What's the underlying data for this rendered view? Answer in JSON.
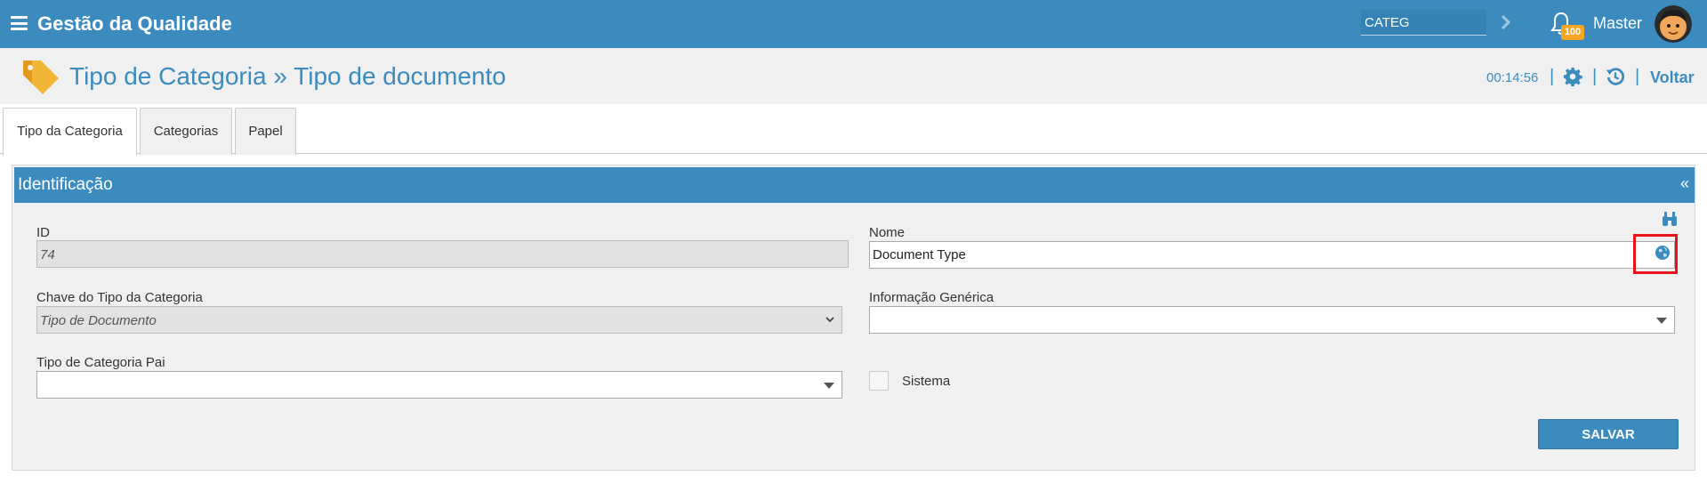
{
  "topbar": {
    "app_title": "Gestão da Qualidade",
    "search_value": "CATEG",
    "notification_count": "100",
    "user_name": "Master"
  },
  "header": {
    "page_title": "Tipo de Categoria » Tipo de documento",
    "timer": "00:14:56",
    "back_label": "Voltar"
  },
  "tabs": [
    {
      "label": "Tipo da Categoria",
      "active": true
    },
    {
      "label": "Categorias",
      "active": false
    },
    {
      "label": "Papel",
      "active": false
    }
  ],
  "panel": {
    "title": "Identificação",
    "collapse_glyph": "«"
  },
  "form": {
    "id_label": "ID",
    "id_value": "74",
    "nome_label": "Nome",
    "nome_value": "Document Type",
    "chave_label": "Chave do Tipo da Categoria",
    "chave_value": "Tipo de Documento",
    "info_label": "Informação Genérica",
    "info_value": "",
    "pai_label": "Tipo de Categoria Pai",
    "pai_value": "",
    "sistema_label": "Sistema",
    "sistema_checked": false,
    "save_label": "SALVAR"
  },
  "colors": {
    "primary": "#3b8bbf",
    "badge": "#f5a623",
    "highlight": "#e8141b"
  },
  "icons": [
    "menu-icon",
    "chevron-right-icon",
    "bell-icon",
    "avatar",
    "tag-icon",
    "gear-icon",
    "history-icon",
    "binoculars-icon",
    "globe-icon"
  ]
}
